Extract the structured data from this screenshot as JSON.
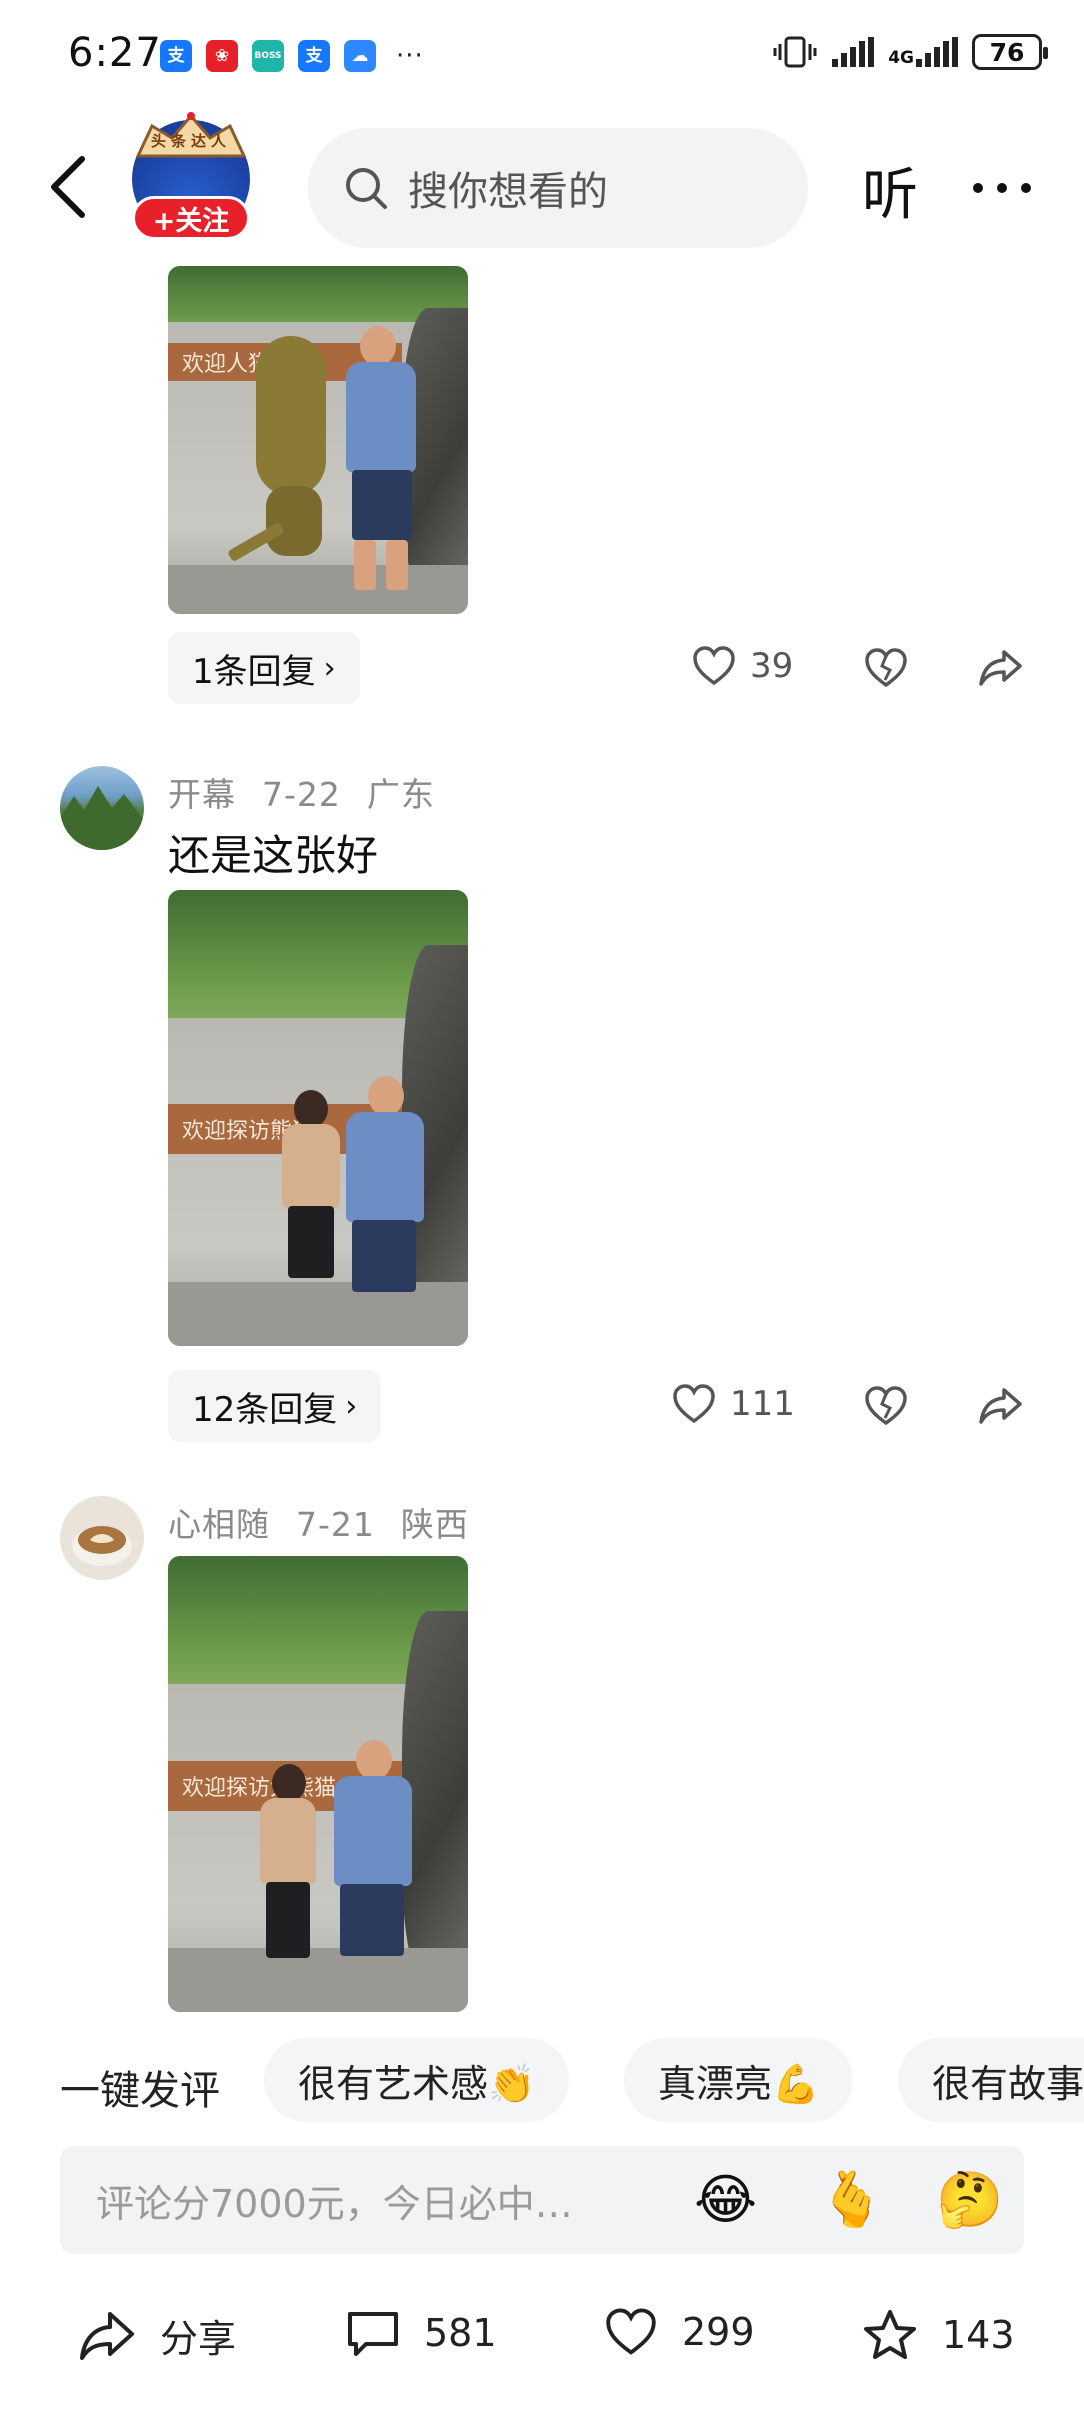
{
  "status_bar": {
    "time": "6:27",
    "apps": [
      {
        "name": "alipay-icon",
        "glyph": "支",
        "color": "#1677ff"
      },
      {
        "name": "app-red-icon",
        "glyph": "❀",
        "color": "#e8202a"
      },
      {
        "name": "boss-zhipin-icon",
        "glyph": "BOSS",
        "color": "#1fb5a8"
      },
      {
        "name": "alipay-icon-2",
        "glyph": "支",
        "color": "#1677ff"
      },
      {
        "name": "weather-icon",
        "glyph": "☁",
        "color": "#2f88ff"
      }
    ],
    "overflow": "···",
    "network": "4G",
    "battery": "76"
  },
  "header": {
    "avatar_badge": "头条达人",
    "follow_label": "+关注",
    "search_placeholder": "搜你想看的",
    "listen_label": "听"
  },
  "comments": [
    {
      "partial": true,
      "replies_label": "1条回复",
      "likes": "39",
      "photo": {
        "sign": "欢迎人猫大熊"
      }
    },
    {
      "user": "开幕",
      "date": "7-22",
      "region": "广东",
      "text": "还是这张好",
      "replies_label": "12条回复",
      "likes": "111",
      "photo": {
        "sign": "欢迎探访熊猫"
      }
    },
    {
      "user": "心相随",
      "date": "7-21",
      "region": "陕西",
      "text": "",
      "photo": {
        "sign": "欢迎探访大熊猫"
      }
    }
  ],
  "quick_reply": {
    "label": "一键发评",
    "chips": [
      "很有艺术感👏",
      "真漂亮💪",
      "很有故事"
    ]
  },
  "comment_input": {
    "placeholder": "评论分7000元，今日必中…",
    "emojis": [
      "😂",
      "🫰",
      "🤔"
    ]
  },
  "bottom_bar": {
    "share_label": "分享",
    "comments_count": "581",
    "likes_count": "299",
    "favorites_count": "143"
  }
}
